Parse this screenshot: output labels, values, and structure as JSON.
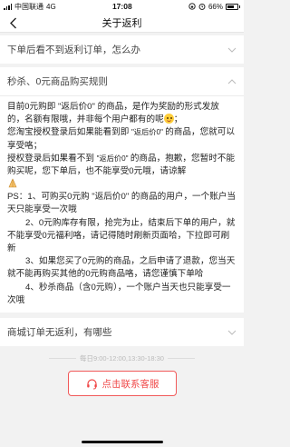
{
  "status_bar": {
    "carrier": "中国联通",
    "network": "4G",
    "time": "17:08",
    "battery": "66%"
  },
  "nav": {
    "title": "关于返利"
  },
  "sections": [
    {
      "title": "下单后看不到返利订单，怎么办",
      "expanded": false
    },
    {
      "title": "秒杀、0元商品购买规则",
      "expanded": true
    },
    {
      "title": "商城订单无返利，有哪些",
      "expanded": false
    }
  ],
  "rules": {
    "p1": "目前0元购即 \"返后价0\" 的商品，是作为奖励的形式发放的，名额有限哦，并非每个用户都有的呢",
    "p2a": "您淘宝授权登录后如果能看到即 ",
    "p2b": "\"返后价0\" ",
    "p2c": "的商品，您就可以享受咯；",
    "p3a": "授权登录后如果看不到 ",
    "p3b": "\"返后价0\" ",
    "p3c": "的商品，抱歉，您暂时不能购买呢，您下单后，也不能享受0元哦，请谅解",
    "ps1": "PS：1、可购买0元购 \"返后价0\" 的商品的用户，一个账户当天只能享受一次哦",
    "ps2": "2、0元购库存有限，抢完为止，结束后下单的用户，就不能享受0元福利咯，请记得随时刷新页面哈，下拉即可刷新",
    "ps3": "3、如果您买了0元购的商品，之后申请了退款，您当天就不能再购买其他的0元购商品咯，请您谨慎下单哈",
    "ps4": "4、秒杀商品（含0元购），一个账户当天也只能享受一次哦"
  },
  "service": {
    "hours": "每日9:00-12:00,13:30-18:30",
    "button_label": "点击联系客服"
  },
  "colors": {
    "accent": "#f04848",
    "background": "#f2f2f2"
  },
  "icons": [
    "back-arrow-icon",
    "chevron-down-icon",
    "chevron-up-icon",
    "smiley-emoji-icon",
    "folded-hands-icon",
    "headset-icon"
  ]
}
